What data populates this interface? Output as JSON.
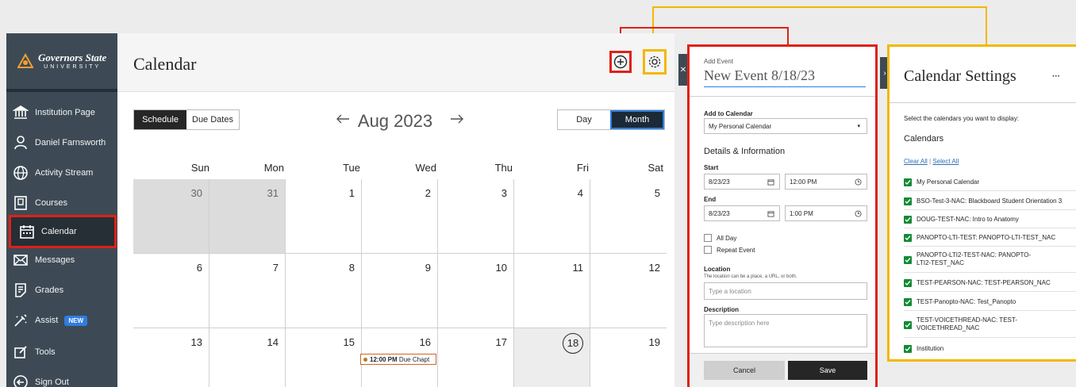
{
  "brand": {
    "name": "Governors State",
    "sub": "UNIVERSITY"
  },
  "sidebar": {
    "items": [
      {
        "label": "Institution Page",
        "icon": "institution-icon"
      },
      {
        "label": "Daniel Farnsworth",
        "icon": "user-icon"
      },
      {
        "label": "Activity Stream",
        "icon": "globe-icon"
      },
      {
        "label": "Courses",
        "icon": "courses-icon"
      },
      {
        "label": "Calendar",
        "icon": "calendar-icon"
      },
      {
        "label": "Messages",
        "icon": "envelope-icon"
      },
      {
        "label": "Grades",
        "icon": "grades-icon"
      },
      {
        "label": "Assist",
        "icon": "assist-icon",
        "badge": "NEW"
      },
      {
        "label": "Tools",
        "icon": "tools-icon"
      },
      {
        "label": "Sign Out",
        "icon": "sign-out-icon"
      }
    ]
  },
  "calendar": {
    "title": "Calendar",
    "views": [
      "Schedule",
      "Due Dates"
    ],
    "month": "Aug 2023",
    "ranges": [
      "Day",
      "Month"
    ],
    "days_of_week": [
      "Sun",
      "Mon",
      "Tue",
      "Wed",
      "Thu",
      "Fri",
      "Sat"
    ],
    "weeks": [
      [
        "30",
        "31",
        "1",
        "2",
        "3",
        "4",
        "5"
      ],
      [
        "6",
        "7",
        "8",
        "9",
        "10",
        "11",
        "12"
      ],
      [
        "13",
        "14",
        "15",
        "16",
        "17",
        "18",
        "19"
      ]
    ],
    "event": {
      "time": "12:00 PM",
      "title": "Due Chapt"
    }
  },
  "add_event": {
    "heading": "Add Event",
    "title": "New Event 8/18/23",
    "add_to_label": "Add to Calendar",
    "calendar_value": "My Personal Calendar",
    "section": "Details & Information",
    "start_label": "Start",
    "start_date": "8/23/23",
    "start_time": "12:00 PM",
    "end_label": "End",
    "end_date": "8/23/23",
    "end_time": "1:00 PM",
    "all_day": "All Day",
    "repeat": "Repeat Event",
    "location_label": "Location",
    "location_hint": "The location can be a place, a URL, or both.",
    "location_placeholder": "Type a location",
    "description_label": "Description",
    "description_placeholder": "Type description here",
    "cancel": "Cancel",
    "save": "Save"
  },
  "settings": {
    "title": "Calendar Settings",
    "more": "···",
    "instruction": "Select the calendars you want to display:",
    "section": "Calendars",
    "clear_all": "Clear All",
    "divider": "|",
    "select_all": "Select All",
    "calendars": [
      "My Personal Calendar",
      "BSO-Test-3-NAC: Blackboard Student Orientation 3",
      "DOUG-TEST-NAC: Intro to Anatomy",
      "PANOPTO-LTI-TEST: PANOPTO-LTI-TEST_NAC",
      "PANOPTO-LTI2-TEST-NAC: PANOPTO-LTI2-TEST_NAC",
      "TEST-PEARSON-NAC: TEST-PEARSON_NAC",
      "TEST-Panopto-NAC: Test_Panopto",
      "TEST-VOICETHREAD-NAC: TEST-VOICETHREAD_NAC",
      "Institution"
    ]
  },
  "colors": {
    "highlight_red": "#e02016",
    "highlight_yellow": "#f2b800",
    "sidebar": "#3d4a55",
    "check": "#138a34"
  }
}
